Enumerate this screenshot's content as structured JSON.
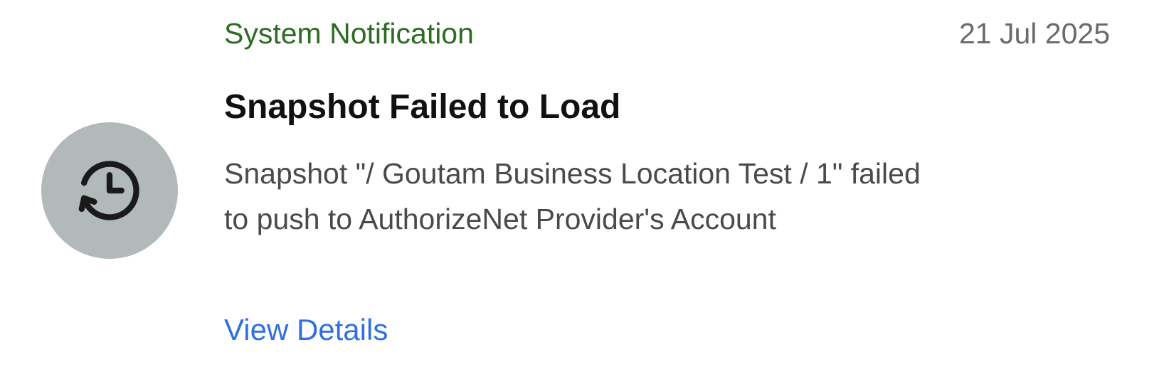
{
  "notification": {
    "category": "System Notification",
    "date": "21 Jul 2025",
    "title": "Snapshot Failed to Load",
    "message": "Snapshot \"/ Goutam Business Location Test / 1\" failed to push to AuthorizeNet Provider's Account",
    "action_label": "View Details",
    "icon": "history-icon"
  },
  "colors": {
    "category": "#2e6b23",
    "date": "#6b6b6b",
    "title": "#111111",
    "message": "#4a4a4a",
    "link": "#2f6fe0",
    "avatar_bg": "#b1b9ba"
  }
}
